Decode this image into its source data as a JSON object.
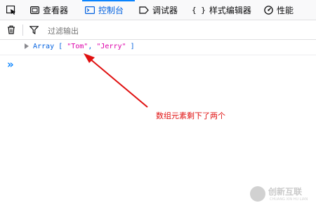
{
  "toolbar": {
    "tabs": [
      {
        "label": "查看器",
        "icon": "inspector-icon"
      },
      {
        "label": "控制台",
        "icon": "console-icon"
      },
      {
        "label": "调试器",
        "icon": "debugger-icon"
      },
      {
        "label": "样式编辑器",
        "icon": "style-editor-icon"
      },
      {
        "label": "性能",
        "icon": "performance-icon"
      }
    ],
    "active_tab": "控制台"
  },
  "filter": {
    "placeholder": "过滤输出"
  },
  "console": {
    "array_label": "Array",
    "open_bracket": "[",
    "item1": "\"Tom\"",
    "separator": ",",
    "item2": "\"Jerry\"",
    "close_bracket": "]",
    "prompt": "»"
  },
  "annotation": {
    "text": "数组元素剩下了两个"
  },
  "watermark": {
    "title": "创新互联",
    "subtitle": "CHUANG XIN HU LIAN"
  },
  "colors": {
    "accent": "#0a84ff",
    "annotation": "#e01010",
    "string": "#dd00a9"
  }
}
